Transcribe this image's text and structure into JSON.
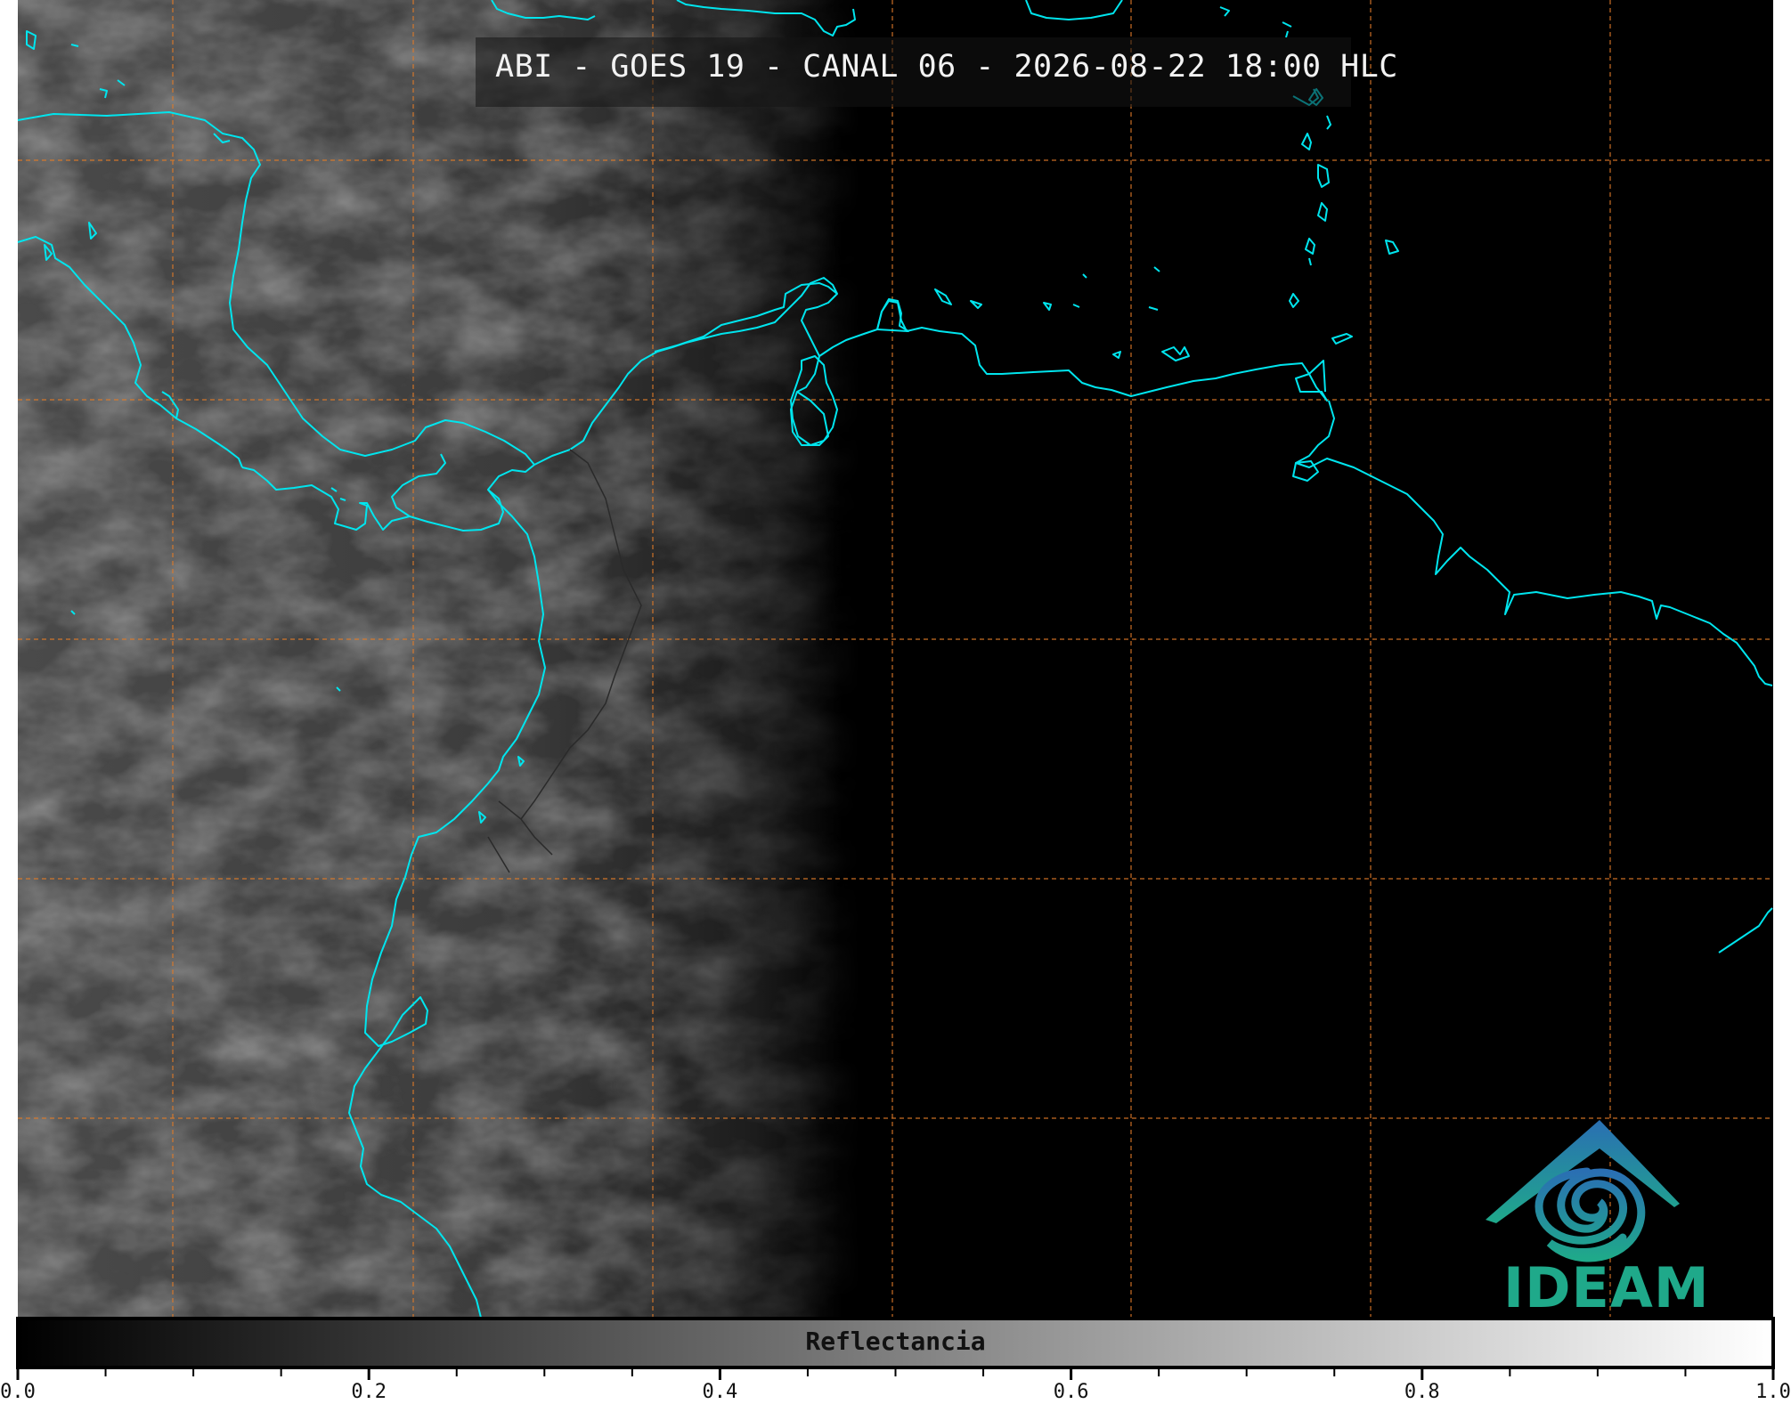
{
  "title": "ABI - GOES 19 - CANAL 06 - 2026-08-22 18:00 HLC",
  "colorbar": {
    "label": "Reflectancia",
    "ticks": [
      "0.0",
      "0.2",
      "0.4",
      "0.6",
      "0.8",
      "1.0"
    ],
    "range": [
      0.0,
      1.0
    ],
    "minor_step": 0.05,
    "colormap": "greys",
    "colors": {
      "low": "#000000",
      "high": "#ffffff"
    }
  },
  "logo": {
    "text": "IDEAM",
    "color": "#1fa98a"
  },
  "map": {
    "coastline_color": "#00e5ee",
    "graticule_color": "#e07b28",
    "background_color": "#000000"
  }
}
